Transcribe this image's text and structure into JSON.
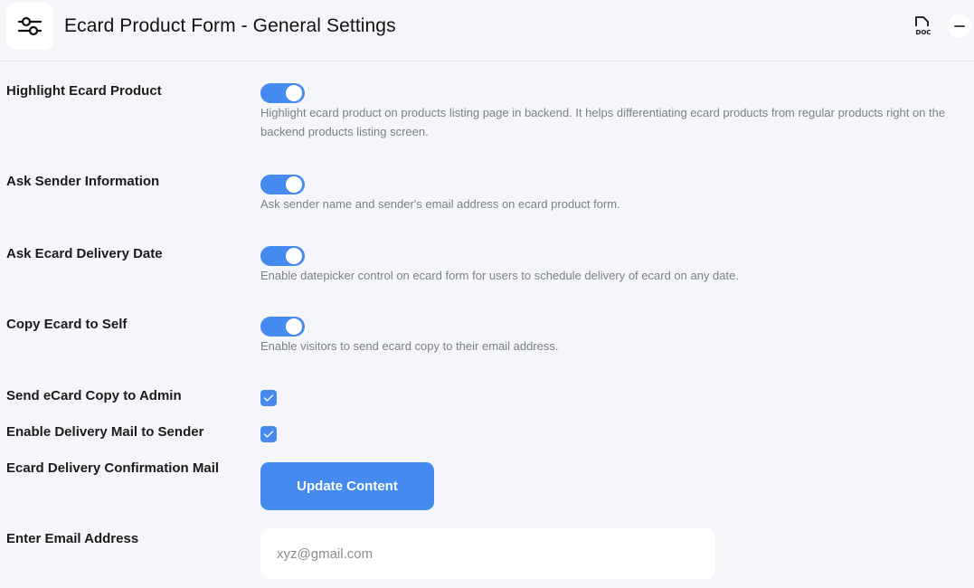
{
  "header": {
    "title": "Ecard Product Form - General Settings",
    "settings_icon": "sliders-icon",
    "doc_icon": "doc-icon",
    "doc_label": "DOC",
    "collapse_icon": "minus-icon"
  },
  "settings": {
    "highlight": {
      "label": "Highlight Ecard Product",
      "enabled": true,
      "description": "Highlight ecard product on products listing page in backend. It helps differentiating ecard products from regular products right on the backend products listing screen."
    },
    "sender_info": {
      "label": "Ask Sender Information",
      "enabled": true,
      "description": "Ask sender name and sender's email address on ecard product form."
    },
    "delivery_date": {
      "label": "Ask Ecard Delivery Date",
      "enabled": true,
      "description": "Enable datepicker control on ecard form for users to schedule delivery of ecard on any date."
    },
    "copy_self": {
      "label": "Copy Ecard to Self",
      "enabled": true,
      "description": "Enable visitors to send ecard copy to their email address."
    },
    "copy_admin": {
      "label": "Send eCard Copy to Admin",
      "checked": true
    },
    "delivery_mail_sender": {
      "label": "Enable Delivery Mail to Sender",
      "checked": true
    },
    "confirmation_mail": {
      "label": "Ecard Delivery Confirmation Mail",
      "button_label": "Update Content"
    },
    "email": {
      "label": "Enter Email Address",
      "placeholder": "xyz@gmail.com",
      "value": ""
    }
  },
  "colors": {
    "accent": "#448aef",
    "background": "#f5f6fa"
  }
}
